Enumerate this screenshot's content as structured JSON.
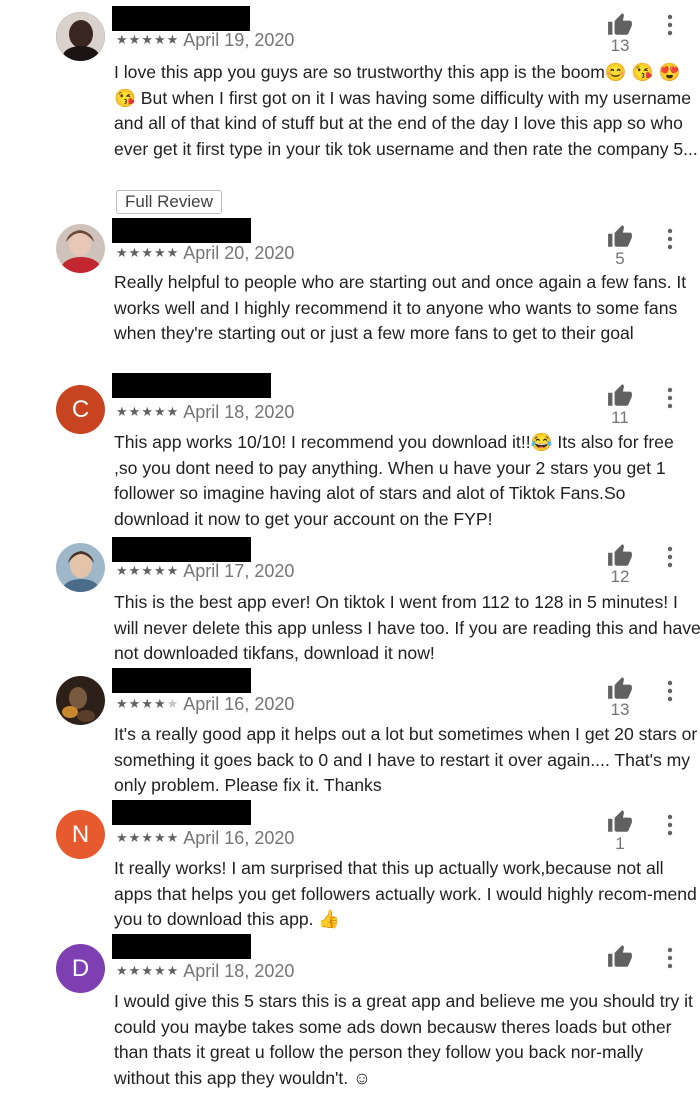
{
  "actions": {
    "full_review": "Full Review"
  },
  "icons": {
    "thumb": "thumbs-up-icon",
    "more": "more-vertical-icon"
  },
  "reviews": [
    {
      "avatar_letter": "",
      "avatar_type": "photo",
      "stars": 5,
      "date": "April 19, 2020",
      "helpful": "13",
      "text": "I love this app you guys are so trustworthy this app is the boom😊 😘 😍 😘  But when I first got on it I was having some difficulty with my username and all of that kind of stuff but at the end of the day I love this app so who ever get it first type in your tik tok username and then rate the company 5..."
    },
    {
      "avatar_letter": "",
      "avatar_type": "photo",
      "stars": 5,
      "date": "April 20, 2020",
      "helpful": "5",
      "text": "Really helpful to people who are starting out and once again a few fans. It works well and I highly recommend it to anyone who wants to some fans when they're starting out or just a few more fans to get to their goal"
    },
    {
      "avatar_letter": "C",
      "avatar_type": "letter",
      "avatar_color": "#c8431f",
      "stars": 5,
      "date": "April 18, 2020",
      "helpful": "11",
      "text": "This app works 10/10! I recommend you download it!!😂 Its also for free ,so you dont need to pay anything. When u have your 2 stars you get 1 follower so imagine having alot of stars and alot of Tiktok Fans.So download it now to get your account on the FYP!"
    },
    {
      "avatar_letter": "",
      "avatar_type": "photo",
      "stars": 5,
      "date": "April 17, 2020",
      "helpful": "12",
      "text": "This is the best app ever! On tiktok I went from 112 to 128 in 5 minutes! I will never delete this app unless I have too. If you are reading this and have not downloaded tikfans, download it now!"
    },
    {
      "avatar_letter": "",
      "avatar_type": "photo",
      "stars": 4,
      "date": "April 16, 2020",
      "helpful": "13",
      "text": "It's a really good app it helps out a lot but sometimes when I get 20 stars or something it goes back to 0 and I have to restart it over again.... That's my only problem. Please fix it. Thanks"
    },
    {
      "avatar_letter": "N",
      "avatar_type": "letter",
      "avatar_color": "#e65a2e",
      "stars": 5,
      "date": "April 16, 2020",
      "helpful": "1",
      "text": "It really works! I am surprised that this up actually work,because not all apps that helps you get followers actually work. I would highly recom-mend you to download this app. 👍"
    },
    {
      "avatar_letter": "D",
      "avatar_type": "letter",
      "avatar_color": "#7e3fb3",
      "stars": 5,
      "date": "April 18, 2020",
      "helpful": "",
      "text": "I would give this 5 stars this is a great app and believe me you should try it could you maybe takes some ads down becausw theres loads but other than thats it great u follow the person they follow you back nor-mally without this app they wouldn't. ☺"
    }
  ]
}
